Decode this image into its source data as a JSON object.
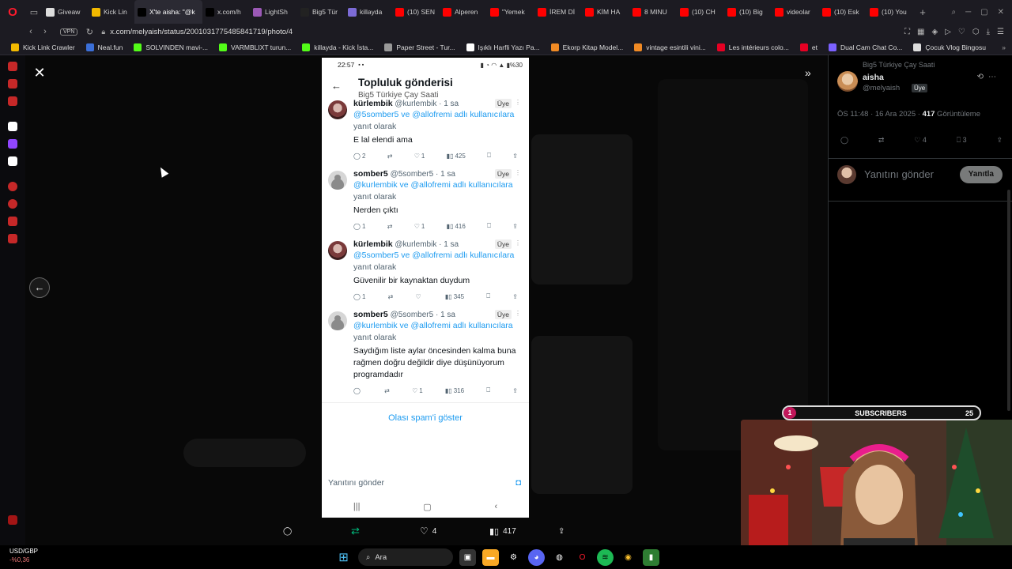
{
  "browser": {
    "tabs": [
      {
        "label": "Giveaw",
        "color": "#dddddd"
      },
      {
        "label": "Kick Lin",
        "color": "#f2b900"
      },
      {
        "label": "X'te aisha: \"@k",
        "color": "#000000",
        "active": true
      },
      {
        "label": "x.com/h",
        "color": "#000000"
      },
      {
        "label": "LightSh",
        "color": "#9b59b6"
      },
      {
        "label": "Big5 Tür",
        "color": "#222222"
      },
      {
        "label": "killayda",
        "color": "#7c6bd6"
      },
      {
        "label": "(10) SEN",
        "color": "#ff0000"
      },
      {
        "label": "Alperen",
        "color": "#ff0000"
      },
      {
        "label": "\"Yemek",
        "color": "#ff0000"
      },
      {
        "label": "İREM Dİ",
        "color": "#ff0000"
      },
      {
        "label": "KİM HA",
        "color": "#ff0000"
      },
      {
        "label": "8 MINU",
        "color": "#ff0000"
      },
      {
        "label": "(10) CH",
        "color": "#ff0000"
      },
      {
        "label": "(10) Big",
        "color": "#ff0000"
      },
      {
        "label": "videolar",
        "color": "#ff0000"
      },
      {
        "label": "(10) Esk",
        "color": "#ff0000"
      },
      {
        "label": "(10) You",
        "color": "#ff0000"
      }
    ],
    "url": "x.com/melyaish/status/2001031775485841719/photo/4",
    "vpn": "VPN",
    "bookmarks": [
      {
        "label": "Kick Link Crawler",
        "color": "#f2b900"
      },
      {
        "label": "Neal.fun",
        "color": "#3b6fd8"
      },
      {
        "label": "SOLVINDEN mavi-...",
        "color": "#53fc18"
      },
      {
        "label": "VARMBLIXT turun...",
        "color": "#53fc18"
      },
      {
        "label": "killayda - Kick İsta...",
        "color": "#53fc18"
      },
      {
        "label": "Paper Street - Tur...",
        "color": "#999999"
      },
      {
        "label": "Işıklı Harfli Yazı Pa...",
        "color": "#ffffff"
      },
      {
        "label": "Ekorp Kitap Model...",
        "color": "#f08a24"
      },
      {
        "label": "vintage esintili vini...",
        "color": "#f08a24"
      },
      {
        "label": "Les intérieurs colo...",
        "color": "#e60023"
      },
      {
        "label": "et",
        "color": "#e60023"
      },
      {
        "label": "Dual Cam Chat Co...",
        "color": "#7b61ff"
      },
      {
        "label": "Çocuk Vlog Bingosu",
        "color": "#dddddd"
      }
    ]
  },
  "phone": {
    "time": "22:57",
    "battery": "%30",
    "title": "Topluluk gönderisi",
    "subtitle": "Big5 Türkiye Çay Saati",
    "tweets": [
      {
        "name": "kürlembik",
        "handle": "@kurlembik · 1 sa",
        "badge": "Üye",
        "reply_prefix": "@5somber5 ve @allofremi adlı kullanıcılara",
        "reply_suffix": "yanıt olarak",
        "text": "E lal elendi ama",
        "replies": "2",
        "likes": "1",
        "views": "425"
      },
      {
        "name": "somber5",
        "handle": "@5somber5 · 1 sa",
        "badge": "Üye",
        "reply_prefix": "@kurlembik ve @allofremi adlı kullanıcılara",
        "reply_suffix": "yanıt olarak",
        "text": "Nerden çıktı",
        "replies": "1",
        "likes": "1",
        "views": "416"
      },
      {
        "name": "kürlembik",
        "handle": "@kurlembik · 1 sa",
        "badge": "Üye",
        "reply_prefix": "@5somber5 ve @allofremi adlı kullanıcılara",
        "reply_suffix": "yanıt olarak",
        "text": "Güvenilir bir kaynaktan duydum",
        "replies": "1",
        "likes": "",
        "views": "345"
      },
      {
        "name": "somber5",
        "handle": "@5somber5 · 1 sa",
        "badge": "Üye",
        "reply_prefix": "@kurlembik ve @allofremi adlı kullanıcılara",
        "reply_suffix": "yanıt olarak",
        "text": "Saydığım liste aylar öncesinden kalma buna rağmen doğru değildir diye düşünüyorum programdadır",
        "replies": "",
        "likes": "1",
        "views": "316"
      }
    ],
    "spam_link": "Olası spam'i göster",
    "reply_placeholder": "Yanıtını gönder"
  },
  "media_actions": {
    "likes": "4",
    "views": "417"
  },
  "right_panel": {
    "community": "Big5 Türkiye Çay Saati",
    "name": "aisha",
    "handle": "@melyaish",
    "badge": "Üye",
    "meta_time": "ÖS 11:48 · 16 Ara 2025 · ",
    "meta_views": "417",
    "meta_views_label": " Görüntüleme",
    "likes": "4",
    "bookmarks": "3",
    "reply_placeholder": "Yanıtını gönder",
    "reply_button": "Yanıtla"
  },
  "overlay": {
    "subscribers_label": "SUBSCRIBERS",
    "sub_count_left": "1",
    "sub_count_right": "25"
  },
  "taskbar": {
    "stock_pair": "USD/GBP",
    "stock_change": "-%0,36",
    "search_label": "Ara"
  }
}
